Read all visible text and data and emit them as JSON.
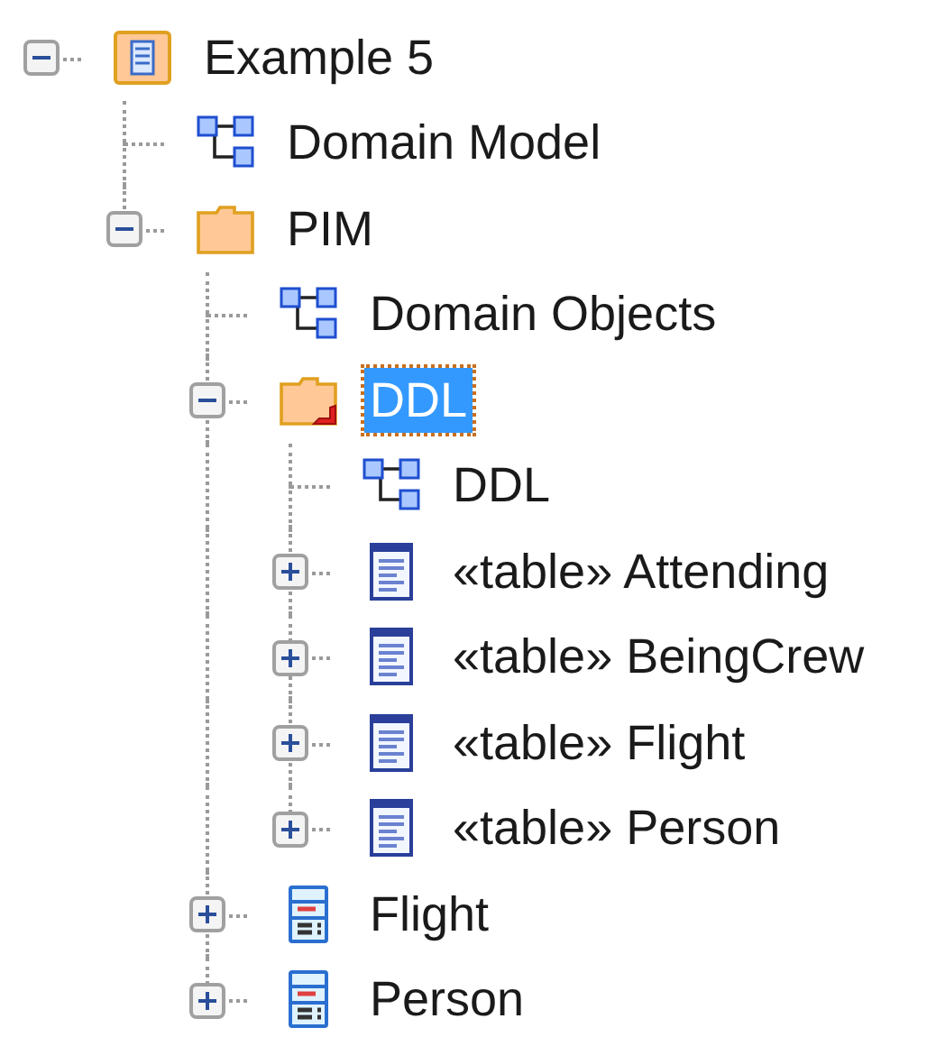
{
  "tree": [
    {
      "label": "Example 5",
      "kind": "model",
      "selected": false,
      "expanded": true,
      "children": [
        {
          "label": "Domain Model",
          "kind": "diagram",
          "selected": false
        },
        {
          "label": "PIM",
          "kind": "folder",
          "selected": false,
          "expanded": true,
          "children": [
            {
              "label": "Domain Objects",
              "kind": "diagram",
              "selected": false
            },
            {
              "label": "DDL",
              "kind": "ddl-folder",
              "selected": true,
              "expanded": true,
              "children": [
                {
                  "label": "DDL",
                  "kind": "diagram",
                  "selected": false
                },
                {
                  "label": "«table» Attending",
                  "kind": "table",
                  "selected": false,
                  "expanded": false
                },
                {
                  "label": "«table» BeingCrew",
                  "kind": "table",
                  "selected": false,
                  "expanded": false
                },
                {
                  "label": "«table» Flight",
                  "kind": "table",
                  "selected": false,
                  "expanded": false
                },
                {
                  "label": "«table» Person",
                  "kind": "table",
                  "selected": false,
                  "expanded": false
                }
              ]
            },
            {
              "label": "Flight",
              "kind": "class",
              "selected": false,
              "expanded": false
            },
            {
              "label": "Person",
              "kind": "class",
              "selected": false,
              "expanded": false
            }
          ]
        }
      ]
    }
  ]
}
